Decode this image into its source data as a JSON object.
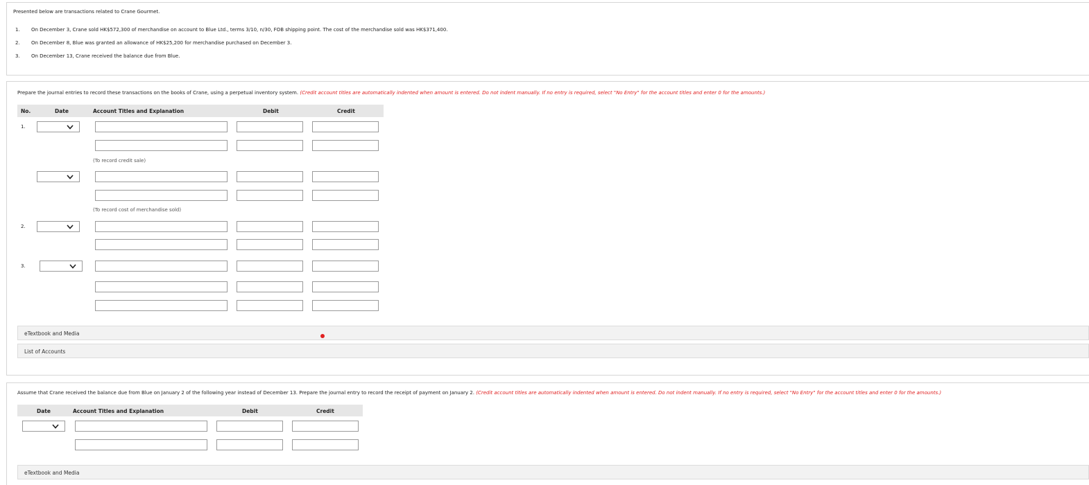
{
  "intro": {
    "text": "Presented below are transactions related to Crane Gourmet.",
    "items": [
      {
        "num": "1.",
        "text": "On December 3, Crane sold HK$572,300 of merchandise on account to Blue Ltd., terms 3/10, n/30, FOB shipping point. The cost of the merchandise sold was HK$371,400."
      },
      {
        "num": "2.",
        "text": "On December 8, Blue was granted an allowance of HK$25,200 for merchandise purchased on December 3."
      },
      {
        "num": "3.",
        "text": "On December 13, Crane received the balance due from Blue."
      }
    ]
  },
  "part1": {
    "instruction": "Prepare the journal entries to record these transactions on the books of Crane, using a perpetual inventory system.",
    "instruction_red": "(Credit account titles are automatically indented when amount is entered. Do not indent manually. If no entry is required, select \"No Entry\" for the account titles and enter 0 for the amounts.)",
    "headers": {
      "no": "No.",
      "date": "Date",
      "account": "Account Titles and Explanation",
      "debit": "Debit",
      "credit": "Credit"
    },
    "entry_numbers": [
      "1.",
      "2.",
      "3."
    ],
    "note_credit_sale": "(To record credit sale)",
    "note_cogs": "(To record cost of merchandise sold)",
    "etextbook": "eTextbook and Media",
    "list_accounts": "List of Accounts"
  },
  "part2": {
    "instruction": "Assume that Crane received the balance due from Blue on January 2 of the following year instead of December 13. Prepare the journal entry to record the receipt of payment on January 2.",
    "instruction_red": "(Credit account titles are automatically indented when amount is entered. Do not indent manually. If no entry is required, select \"No Entry\" for the account titles and enter 0 for the amounts.)",
    "headers": {
      "date": "Date",
      "account": "Account Titles and Explanation",
      "debit": "Debit",
      "credit": "Credit"
    },
    "etextbook": "eTextbook and Media"
  },
  "colors": {
    "accent_red": "#e02020",
    "header_bg": "#e6e6e6"
  },
  "icons": {
    "dropdown": "chevron-down-icon",
    "status_dot": "red-dot-icon"
  }
}
